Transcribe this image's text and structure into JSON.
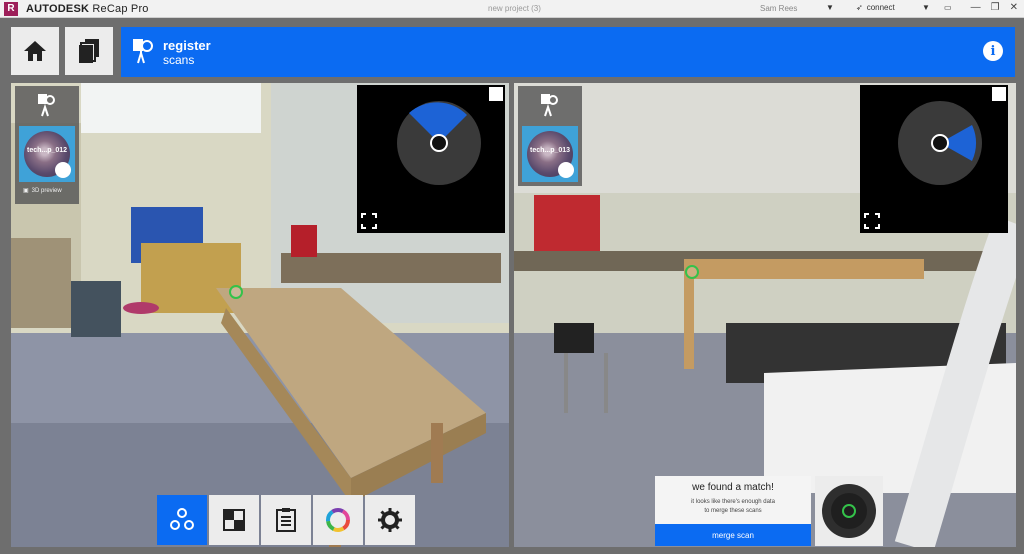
{
  "titlebar": {
    "logo_letter": "R",
    "brand": "AUTODESK",
    "product": "ReCap Pro",
    "document": "new project (3)",
    "user": "Sam Rees",
    "connect_label": "connect"
  },
  "banner": {
    "title": "register",
    "subtitle": "scans",
    "info_glyph": "i"
  },
  "left_scan": {
    "name": "tech...p_012",
    "preview_label": "3D preview"
  },
  "right_scan": {
    "name": "tech...p_013"
  },
  "match_panel": {
    "heading": "we found a match!",
    "body_line1": "it looks like there's enough data",
    "body_line2": "to merge these scans",
    "button": "merge scan"
  },
  "icons": {
    "home": "home-icon",
    "projects": "documents-icon",
    "register": "register-pin-icon",
    "info": "info-icon",
    "tools": [
      "nodes-icon",
      "checker-icon",
      "clipboard-icon",
      "color-wheel-icon",
      "gear-icon"
    ]
  },
  "colors": {
    "accent": "#0b6bf2",
    "app_logo": "#9d1f59",
    "target": "#34c24a"
  }
}
